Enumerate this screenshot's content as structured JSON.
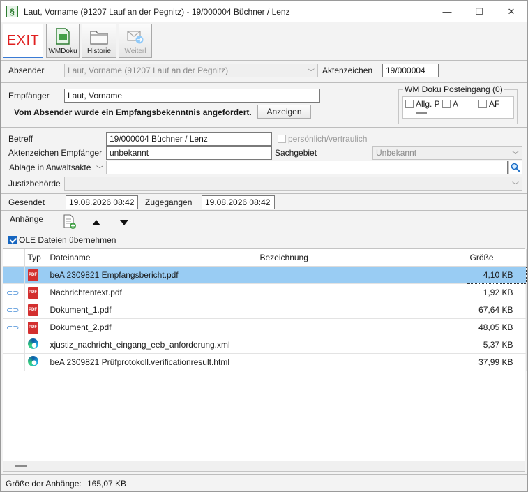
{
  "window": {
    "title": "Laut, Vorname (91207 Lauf an der Pegnitz) - 19/000004 Büchner / Lenz",
    "app_icon": "§",
    "controls": [
      "—",
      "☐",
      "✕"
    ]
  },
  "toolbar": {
    "exit_label": "EXIT",
    "wmdoku_label": "WMDoku",
    "historie_label": "Historie",
    "weiterl_label": "Weiterl"
  },
  "absender": {
    "label": "Absender",
    "value": "Laut, Vorname (91207 Lauf an der Pegnitz)",
    "aktenzeichen_label": "Aktenzeichen",
    "aktenzeichen_value": "19/000004"
  },
  "empfaenger": {
    "label": "Empfänger",
    "value": "Laut, Vorname",
    "notice": "Vom Absender wurde ein Empfangsbekenntnis angefordert.",
    "anzeigen_label": "Anzeigen"
  },
  "wm_doku": {
    "title": "WM Doku Posteingang (0)",
    "opt1": "Allg. P",
    "opt2": "A",
    "opt3": "AF"
  },
  "details": {
    "betreff_label": "Betreff",
    "betreff_value": "19/000004 Büchner / Lenz",
    "persoenlich_label": "persönlich/vertraulich",
    "az_empf_label": "Aktenzeichen Empfänger",
    "az_empf_value": "unbekannt",
    "sachgebiet_label": "Sachgebiet",
    "sachgebiet_value": "Unbekannt",
    "ablage_value": "Ablage in Anwaltsakte",
    "justiz_label": "Justizbehörde",
    "gesendet_label": "Gesendet",
    "gesendet_value": "19.08.2026 08:42",
    "zugegangen_label": "Zugegangen",
    "zugegangen_value": "19.08.2026 08:42"
  },
  "anhaenge": {
    "label": "Anhänge",
    "ole_label": "OLE Dateien übernehmen",
    "columns": [
      "Typ",
      "Dateiname",
      "Bezeichnung",
      "Größe"
    ],
    "rows": [
      {
        "attached": false,
        "type": "pdf",
        "name": "beA 2309821 Empfangsbericht.pdf",
        "desc": "",
        "size": "4,10 KB"
      },
      {
        "attached": true,
        "type": "pdf",
        "name": "Nachrichtentext.pdf",
        "desc": "",
        "size": "1,92 KB"
      },
      {
        "attached": true,
        "type": "pdf",
        "name": "Dokument_1.pdf",
        "desc": "",
        "size": "67,64 KB"
      },
      {
        "attached": true,
        "type": "pdf",
        "name": "Dokument_2.pdf",
        "desc": "",
        "size": "48,05 KB"
      },
      {
        "attached": false,
        "type": "edge",
        "name": "xjustiz_nachricht_eingang_eeb_anforderung.xml",
        "desc": "",
        "size": "5,37 KB"
      },
      {
        "attached": false,
        "type": "edge",
        "name": "beA 2309821 Prüfprotokoll.verificationresult.html",
        "desc": "",
        "size": "37,99 KB"
      }
    ]
  },
  "footer": {
    "label": "Größe der Anhänge:",
    "value": "165,07 KB"
  }
}
